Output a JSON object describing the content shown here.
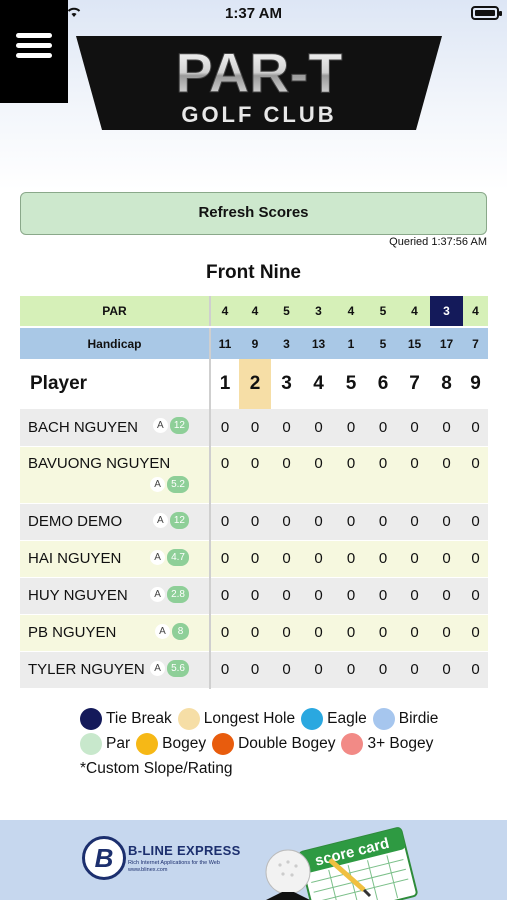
{
  "status": {
    "time": "1:37 AM"
  },
  "logo": {
    "line1": "PAR-T",
    "line2": "GOLF CLUB"
  },
  "refresh": {
    "label": "Refresh Scores"
  },
  "queried": "Queried 1:37:56 AM",
  "section_title": "Front Nine",
  "table": {
    "par_label": "PAR",
    "handicap_label": "Handicap",
    "player_label": "Player",
    "holes": [
      "1",
      "2",
      "3",
      "4",
      "5",
      "6",
      "7",
      "8",
      "9"
    ],
    "par": [
      "4",
      "4",
      "5",
      "3",
      "4",
      "5",
      "4",
      "3",
      "4"
    ],
    "handicap": [
      "11",
      "9",
      "3",
      "13",
      "1",
      "5",
      "15",
      "17",
      "7"
    ],
    "players": [
      {
        "name": "BACH NGUYEN",
        "tag": "A",
        "hcp": "12",
        "scores": [
          "0",
          "0",
          "0",
          "0",
          "0",
          "0",
          "0",
          "0",
          "0"
        ]
      },
      {
        "name": "BAVUONG NGUYEN",
        "tag": "A",
        "hcp": "5.2",
        "scores": [
          "0",
          "0",
          "0",
          "0",
          "0",
          "0",
          "0",
          "0",
          "0"
        ]
      },
      {
        "name": "DEMO DEMO",
        "tag": "A",
        "hcp": "12",
        "scores": [
          "0",
          "0",
          "0",
          "0",
          "0",
          "0",
          "0",
          "0",
          "0"
        ]
      },
      {
        "name": "HAI NGUYEN",
        "tag": "A",
        "hcp": "4.7",
        "scores": [
          "0",
          "0",
          "0",
          "0",
          "0",
          "0",
          "0",
          "0",
          "0"
        ]
      },
      {
        "name": "HUY NGUYEN",
        "tag": "A",
        "hcp": "2.8",
        "scores": [
          "0",
          "0",
          "0",
          "0",
          "0",
          "0",
          "0",
          "0",
          "0"
        ]
      },
      {
        "name": "PB NGUYEN",
        "tag": "A",
        "hcp": "8",
        "scores": [
          "0",
          "0",
          "0",
          "0",
          "0",
          "0",
          "0",
          "0",
          "0"
        ]
      },
      {
        "name": "TYLER NGUYEN",
        "tag": "A",
        "hcp": "5.6",
        "scores": [
          "0",
          "0",
          "0",
          "0",
          "0",
          "0",
          "0",
          "0",
          "0"
        ]
      }
    ]
  },
  "legend": {
    "items": [
      {
        "label": "Tie Break",
        "color": "#141a5a"
      },
      {
        "label": "Longest Hole",
        "color": "#f6dea6"
      },
      {
        "label": "Eagle",
        "color": "#2aa8e0"
      },
      {
        "label": "Birdie",
        "color": "#a6c6ee"
      },
      {
        "label": "Par",
        "color": "#c8e8cc"
      },
      {
        "label": "Bogey",
        "color": "#f6b816"
      },
      {
        "label": "Double Bogey",
        "color": "#e85c0d"
      },
      {
        "label": "3+ Bogey",
        "color": "#f28a86"
      }
    ],
    "note": "*Custom Slope/Rating"
  },
  "banner": {
    "company": "B-LINE EXPRESS",
    "tagline": "Rich Internet Applications for the Web",
    "url": "www.blinex.com",
    "card_text": "score card"
  }
}
